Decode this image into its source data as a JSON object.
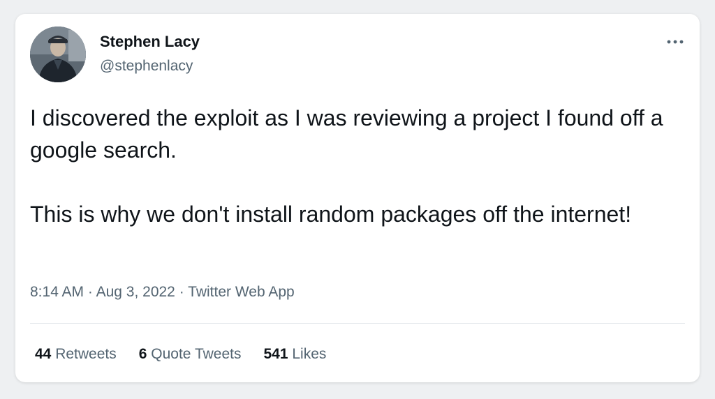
{
  "author": {
    "name": "Stephen Lacy",
    "handle": "@stephenlacy"
  },
  "tweet": {
    "paragraphs": [
      "I discovered the exploit as I was reviewing a project I found off a google search.",
      "This is why we don't install random packages off the internet!"
    ],
    "time": "8:14 AM",
    "date": "Aug 3, 2022",
    "source": "Twitter Web App",
    "separator": "·"
  },
  "stats": {
    "retweets": {
      "count": "44",
      "label": "Retweets"
    },
    "quote_tweets": {
      "count": "6",
      "label": "Quote Tweets"
    },
    "likes": {
      "count": "541",
      "label": "Likes"
    }
  },
  "icons": {
    "more": "more-horizontal-icon"
  },
  "colors": {
    "text_primary": "#0f1419",
    "text_secondary": "#536471",
    "card_background": "#ffffff",
    "page_background": "#eef0f2"
  }
}
